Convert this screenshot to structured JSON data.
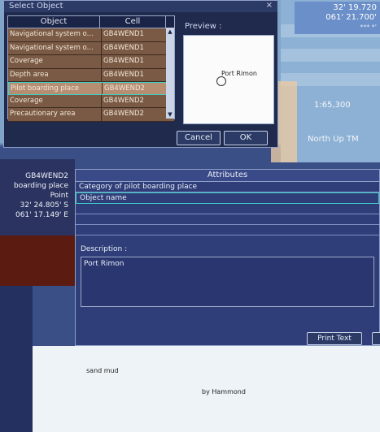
{
  "dialog": {
    "title": "Select Object",
    "close": "×",
    "columns": [
      "Object",
      "Cell"
    ],
    "rows": [
      {
        "object": "Navigational system o...",
        "cell": "GB4WEND1"
      },
      {
        "object": "Navigational system o...",
        "cell": "GB4WEND1"
      },
      {
        "object": "Coverage",
        "cell": "GB4WEND1"
      },
      {
        "object": "Depth area",
        "cell": "GB4WEND1"
      },
      {
        "object": "Pilot boarding place",
        "cell": "GB4WEND2"
      },
      {
        "object": "Coverage",
        "cell": "GB4WEND2"
      },
      {
        "object": "Precautionary area",
        "cell": "GB4WEND2"
      }
    ],
    "preview_label": "Preview :",
    "preview_text": "Port Rimon",
    "cancel": "Cancel",
    "ok": "OK"
  },
  "status": {
    "lat": "32' 19.720",
    "lon": "061' 21.700'",
    "small": "*** *'",
    "scale": "1:65,300",
    "mode": "North  Up TM"
  },
  "info": {
    "cell": "GB4WEND2",
    "type": "boarding place",
    "geom": "Point",
    "lat": "32' 24.805' S",
    "lon": "061' 17.149' E"
  },
  "attributes": {
    "header": "Attributes",
    "category": "Category of pilot boarding place",
    "object_name": "Object name",
    "description_label": "Description :",
    "description": "Port Rimon",
    "print": "Print Text"
  },
  "chart_labels": {
    "sand": "sand mud",
    "hammond": "by Hammond"
  }
}
